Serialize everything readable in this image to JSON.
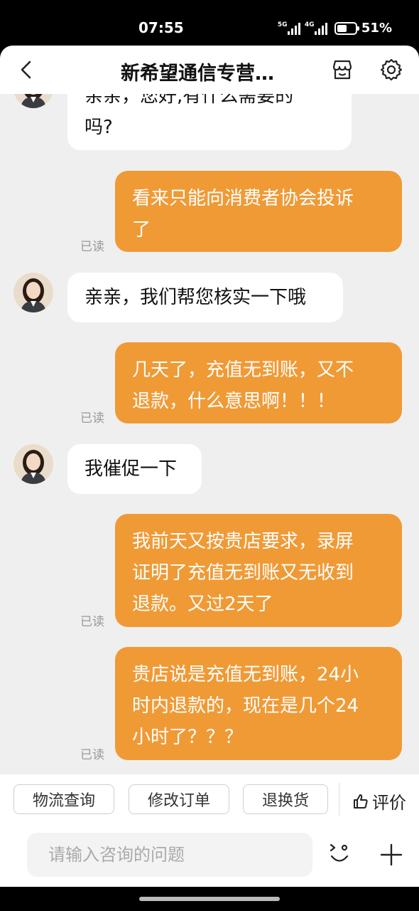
{
  "status_bar": {
    "time": "07:55",
    "net1": "5G",
    "net2": "4G",
    "battery": "51%",
    "battery_level": 0.51
  },
  "header": {
    "title": "新希望通信专营…"
  },
  "messages": [
    {
      "side": "in",
      "lines": [
        "亲亲，您好,有什么需要的",
        "吗?"
      ]
    },
    {
      "side": "out",
      "lines": [
        "看来只能向消费者协会投诉",
        "了"
      ],
      "status": "已读"
    },
    {
      "side": "in",
      "lines": [
        "亲亲，我们帮您核实一下哦"
      ]
    },
    {
      "side": "out",
      "lines": [
        "几天了，充值无到账，又不",
        "退款，什么意思啊！！！"
      ],
      "status": "已读"
    },
    {
      "side": "in",
      "lines": [
        "我催促一下"
      ]
    },
    {
      "side": "out",
      "lines": [
        "我前天又按贵店要求，录屏",
        "证明了充值无到账又无收到",
        "退款。又过2天了"
      ],
      "status": "已读"
    },
    {
      "side": "out",
      "lines": [
        "贵店说是充值无到账，24小",
        "时内退款的，现在是几个24",
        "小时了？？？"
      ],
      "status": "已读"
    }
  ],
  "quick_actions": {
    "logistics": "物流查询",
    "modify_order": "修改订单",
    "return_exchange": "退换货",
    "rate": "评价"
  },
  "input": {
    "placeholder": "请输入咨询的问题"
  },
  "colors": {
    "outgoing_bubble": "#f09a36",
    "incoming_bubble": "#ffffff",
    "chat_bg": "#efefef"
  }
}
